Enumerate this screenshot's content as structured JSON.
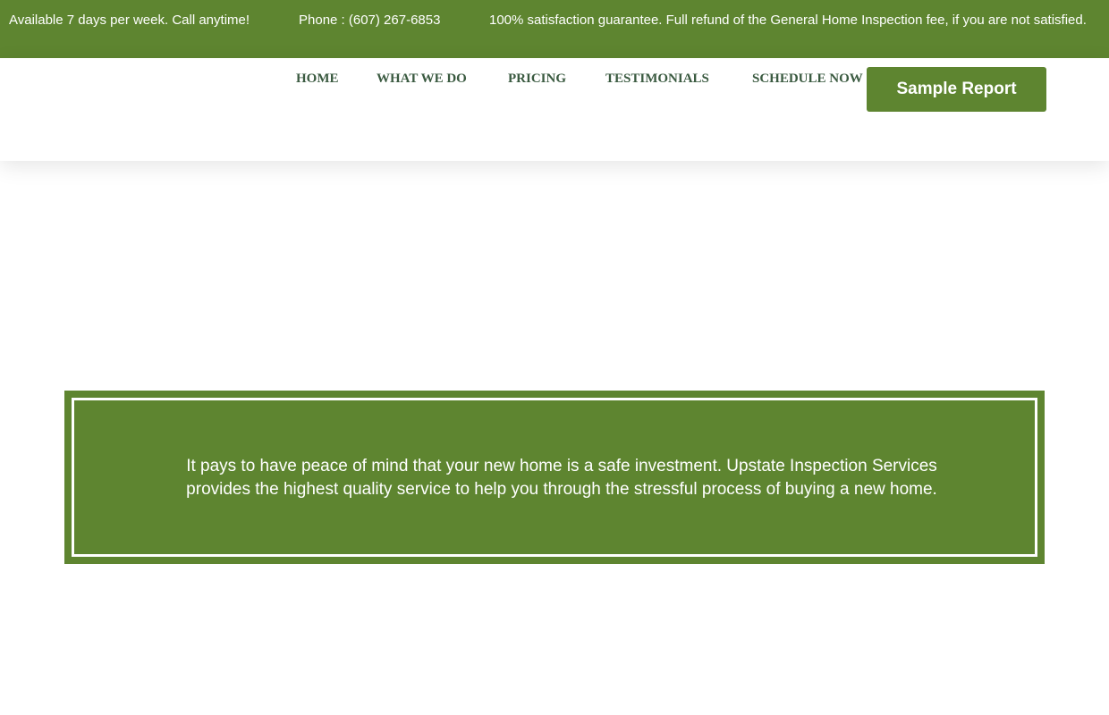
{
  "topbar": {
    "availability": "Available 7 days per week. Call anytime!",
    "phone": "Phone : (607) 267-6853",
    "guarantee": "100% satisfaction guarantee. Full refund of the General Home Inspection fee, if you are not satisfied."
  },
  "nav": {
    "items": [
      {
        "label": "HOME"
      },
      {
        "label": "WHAT WE DO"
      },
      {
        "label": "PRICING"
      },
      {
        "label": "TESTIMONIALS"
      },
      {
        "label": "SCHEDULE NOW"
      }
    ],
    "cta_label": "Sample Report"
  },
  "promo": {
    "text": "It pays to have peace of mind that your new home is a safe investment. Upstate Inspection Services provides the highest quality service to help you through the stressful process of buying a new home."
  },
  "colors": {
    "brand_green": "#5e8530",
    "nav_text": "#3a5a40",
    "white": "#ffffff"
  }
}
